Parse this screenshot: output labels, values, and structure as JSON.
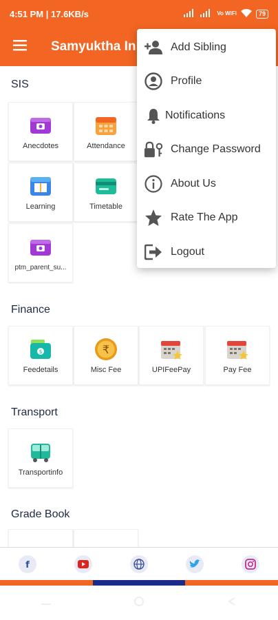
{
  "status": {
    "time_speed": "4:51 PM | 17.6KB/s",
    "network": "Vo WiFi",
    "battery": "79"
  },
  "app_bar": {
    "title": "Samyuktha In"
  },
  "sections": {
    "sis": {
      "title": "SIS",
      "tiles": [
        {
          "label": "Anecdotes",
          "icon": "wallet-purple-icon"
        },
        {
          "label": "Attendance",
          "icon": "calendar-orange-icon"
        },
        {
          "label": "Learning",
          "icon": "book-blue-icon"
        },
        {
          "label": "Timetable",
          "icon": "card-green-icon"
        },
        {
          "label": "ptm_parent_su...",
          "icon": "wallet-purple-icon"
        }
      ]
    },
    "finance": {
      "title": "Finance",
      "tiles": [
        {
          "label": "Feedetails",
          "icon": "money-green-icon"
        },
        {
          "label": "Misc Fee",
          "icon": "rupee-coin-icon"
        },
        {
          "label": "UPIFeePay",
          "icon": "calendar-star-icon"
        },
        {
          "label": "Pay Fee",
          "icon": "calendar-star-icon"
        }
      ]
    },
    "transport": {
      "title": "Transport",
      "tiles": [
        {
          "label": "Transportinfo",
          "icon": "bus-icon"
        }
      ]
    },
    "grade_book": {
      "title": "Grade Book"
    }
  },
  "menu": {
    "items": [
      {
        "label": "Add Sibling",
        "icon": "add-person-icon"
      },
      {
        "label": "Profile",
        "icon": "profile-icon"
      },
      {
        "label": "Notifications",
        "icon": "bell-icon"
      },
      {
        "label": "Change Password",
        "icon": "lock-key-icon"
      },
      {
        "label": "About Us",
        "icon": "info-icon"
      },
      {
        "label": "Rate The App",
        "icon": "star-icon"
      },
      {
        "label": "Logout",
        "icon": "logout-icon"
      }
    ]
  },
  "social": [
    "facebook-icon",
    "youtube-icon",
    "globe-icon",
    "twitter-icon",
    "instagram-icon"
  ],
  "colors": {
    "brand": "#f26522",
    "stripe_blue": "#1c2b8a"
  }
}
